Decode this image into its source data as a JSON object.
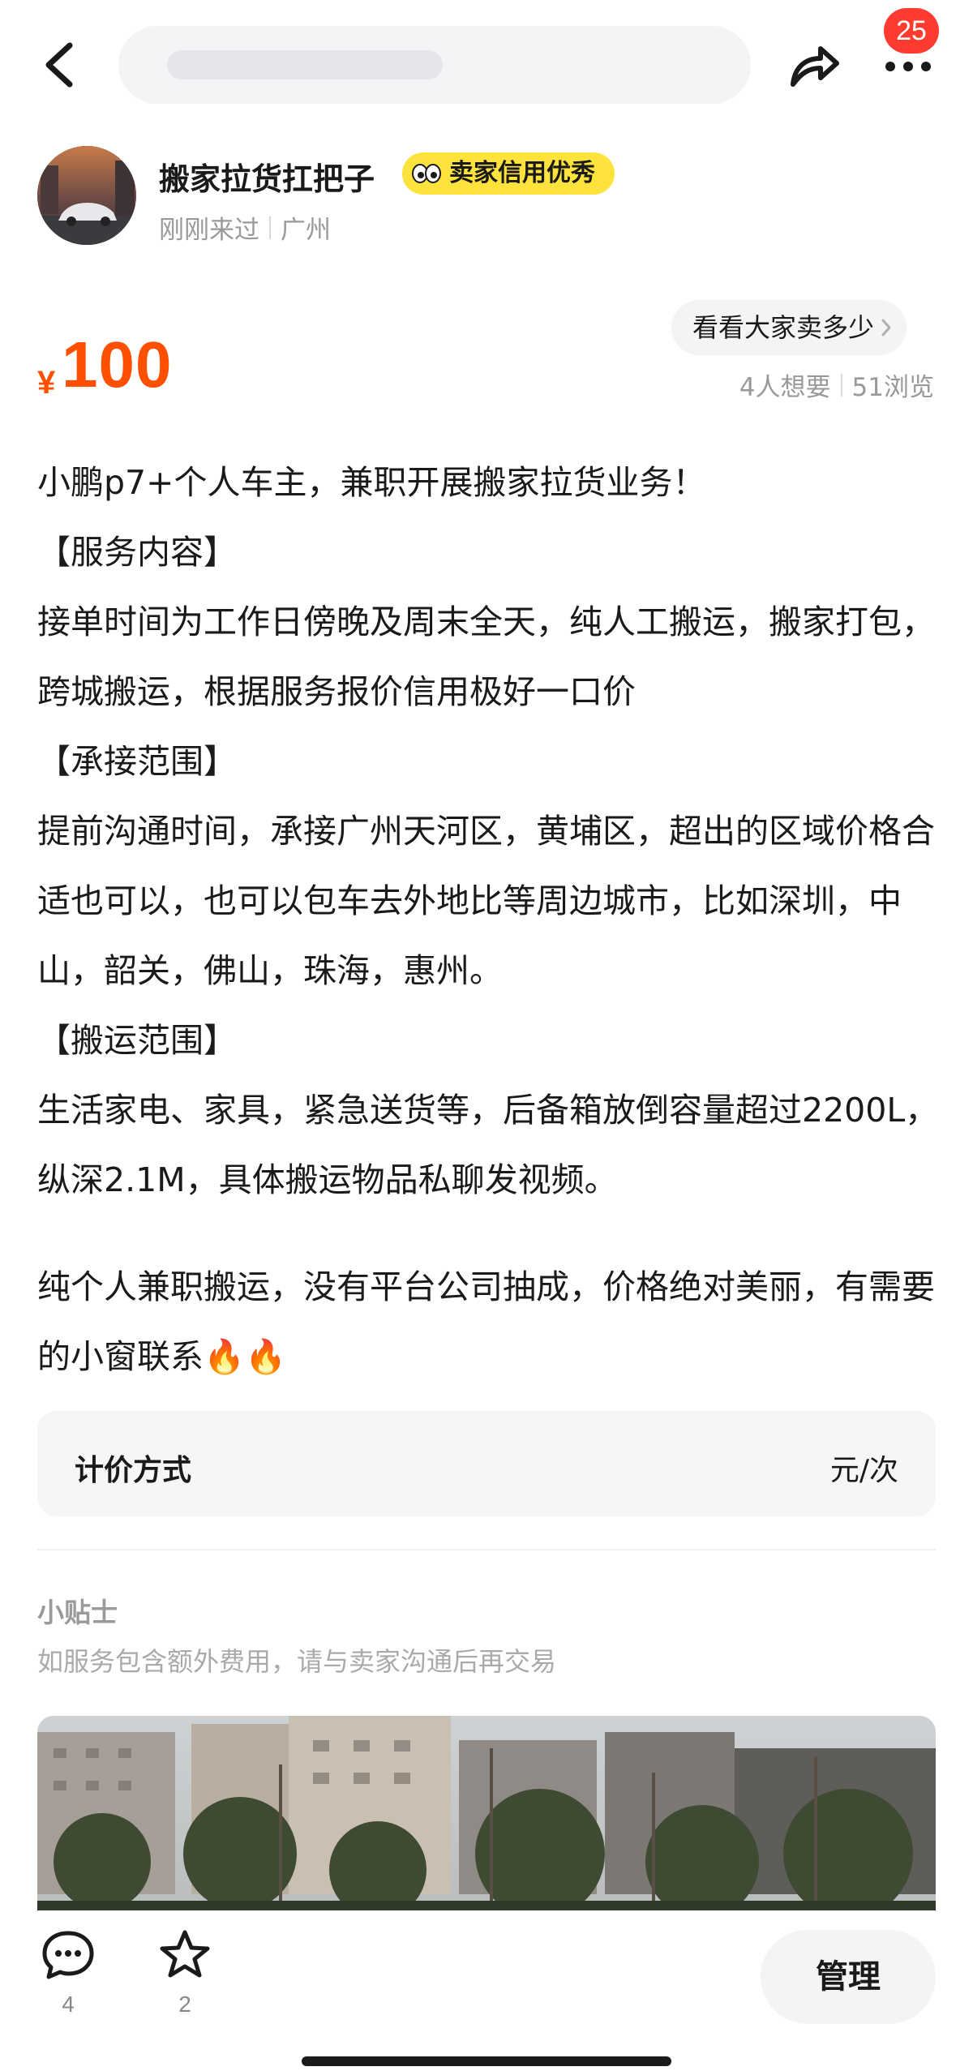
{
  "topbar": {
    "notification_count": "25",
    "icons": [
      "chevron-left-icon",
      "share-arrow-icon",
      "more-dots-icon"
    ]
  },
  "seller": {
    "name": "搬家拉货扛把子",
    "credit_badge": "卖家信用优秀",
    "last_seen": "刚刚来过",
    "location": "广州"
  },
  "price": {
    "currency": "¥",
    "amount": "100",
    "compare_button": "看看大家卖多少",
    "wants": "4人想要",
    "views": "51浏览",
    "accent_color": "#ff5000"
  },
  "description": {
    "line1": "小鹏p7+个人车主，兼职开展搬家拉货业务！",
    "section1_title": "【服务内容】",
    "section1_body": "接单时间为工作日傍晚及周末全天，纯人工搬运，搬家打包，跨城搬运，根据服务报价信用极好一口价",
    "section2_title": "【承接范围】",
    "section2_body": "提前沟通时间，承接广州天河区，黄埔区，超出的区域价格合适也可以，也可以包车去外地比等周边城市，比如深圳，中山，韶关，佛山，珠海，惠州。",
    "section3_title": "【搬运范围】",
    "section3_body": "生活家电、家具，紧急送货等，后备箱放倒容量超过2200L，纵深2.1M，具体搬运物品私聊发视频。",
    "closing": "纯个人兼职搬运，没有平台公司抽成，价格绝对美丽，有需要的小窗联系🔥🔥"
  },
  "pricing": {
    "label": "计价方式",
    "value": "元/次"
  },
  "tips": {
    "title": "小贴士",
    "text": "如服务包含额外费用，请与卖家沟通后再交易"
  },
  "bottombar": {
    "comments_count": "4",
    "favorites_count": "2",
    "manage_label": "管理",
    "icons": [
      "comment-bubble-icon",
      "star-icon"
    ]
  }
}
